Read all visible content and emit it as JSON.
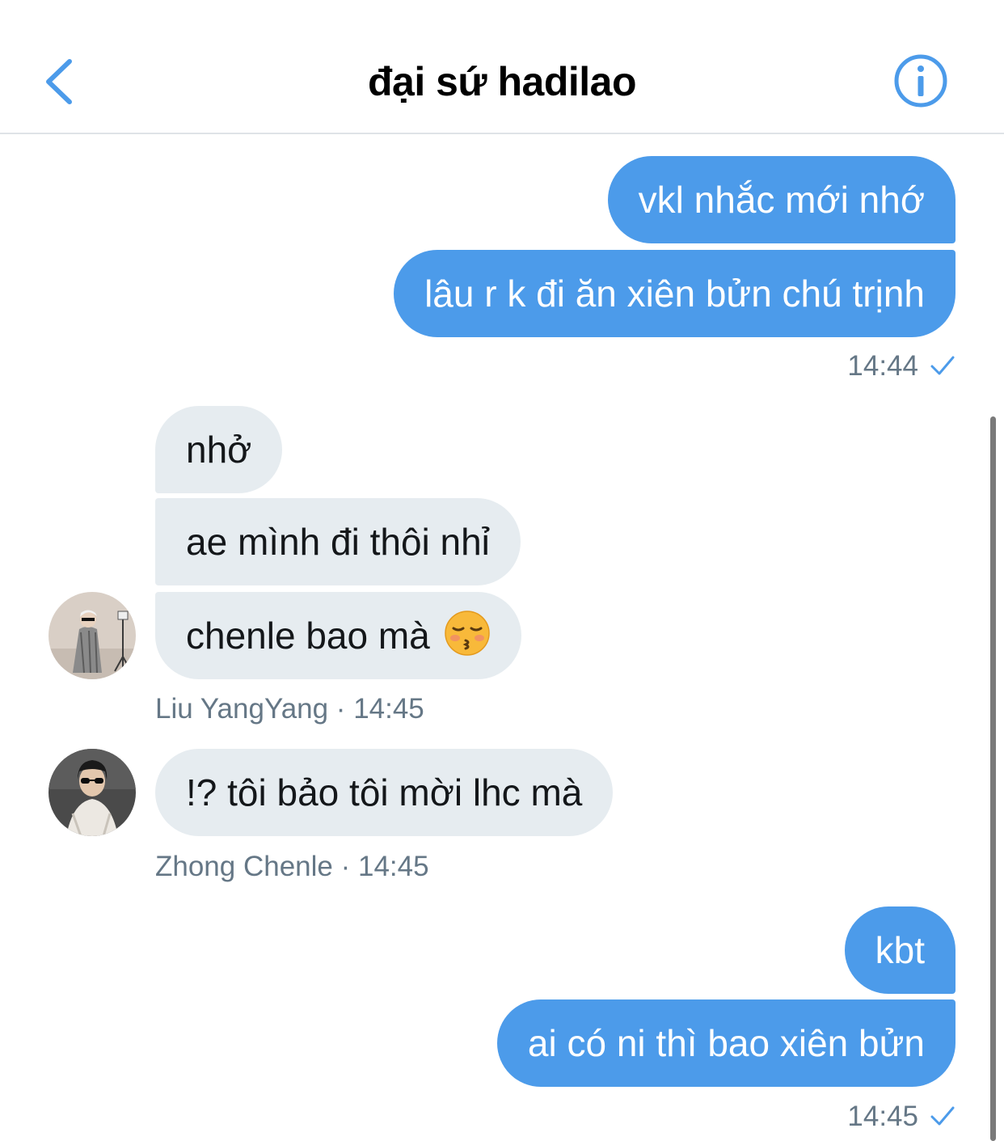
{
  "header": {
    "title": "đại sứ hadilao",
    "back_icon": "chevron-left-icon",
    "info_icon": "info-circle-icon"
  },
  "colors": {
    "accent": "#4c9bea",
    "incoming_bubble": "#e6ecf0",
    "meta_text": "#657786"
  },
  "messages": {
    "m1": "vkl nhắc mới nhớ",
    "m2": "lâu r k đi ăn xiên bửn chú trịnh",
    "time1": "14:44",
    "m3": "nhở",
    "m4": "ae mình đi thôi nhỉ",
    "m5": "chenle bao mà",
    "m5_emoji": "kissing-face-with-closed-eyes-emoji",
    "sender1": "Liu YangYang · 14:45",
    "m6": "!? tôi bảo tôi mời lhc mà",
    "sender2": "Zhong Chenle · 14:45",
    "m7": "kbt",
    "m8": "ai có ni thì bao xiên bửn",
    "time2": "14:45"
  }
}
